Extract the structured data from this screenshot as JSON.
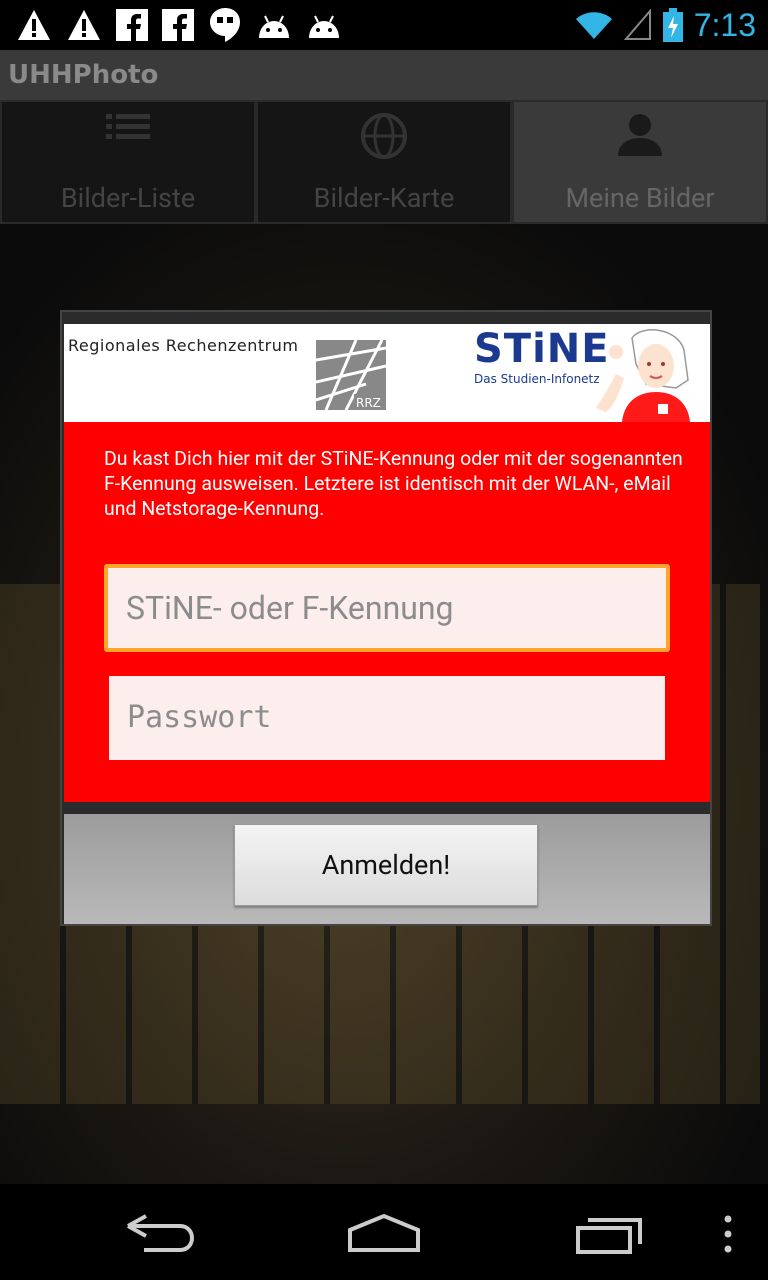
{
  "statusbar": {
    "time": "7:13",
    "notification_icons": [
      "warning-icon",
      "warning-icon",
      "facebook-icon",
      "facebook-icon",
      "hangouts-icon",
      "android-icon",
      "android-icon"
    ],
    "status_icons": [
      "wifi-icon",
      "signal-icon",
      "battery-charging-icon"
    ],
    "time_color": "#33b5e5"
  },
  "app": {
    "title": "UHHPhoto"
  },
  "tabs": [
    {
      "label": "Bilder-Liste",
      "icon": "list-icon",
      "active": false
    },
    {
      "label": "Bilder-Karte",
      "icon": "globe-icon",
      "active": false
    },
    {
      "label": "Meine Bilder",
      "icon": "person-icon",
      "active": true
    }
  ],
  "dialog": {
    "banner": {
      "rrz_text": "Regionales Rechenzentrum",
      "rrz_logo_label": "RRZ",
      "stine_title": "STiNE",
      "stine_subtitle": "Das Studien-Infonetz"
    },
    "info_text": "Du kast Dich hier mit der STiNE-Kennung oder mit der sogenannten F-Kennung ausweisen. Letztere ist identisch mit der  WLAN-, eMail und Netstorage-Kennung.",
    "username_field": {
      "value": "",
      "placeholder": "STiNE- oder F-Kennung"
    },
    "password_field": {
      "value": "",
      "placeholder": "Passwort"
    },
    "login_button": "Anmelden!",
    "colors": {
      "panel": "#fe0000",
      "focus_border": "#ffa52a",
      "field_bg": "#fdeeee"
    }
  },
  "navbar": {
    "buttons": [
      "back-icon",
      "home-icon",
      "recents-icon",
      "overflow-menu-icon"
    ]
  }
}
